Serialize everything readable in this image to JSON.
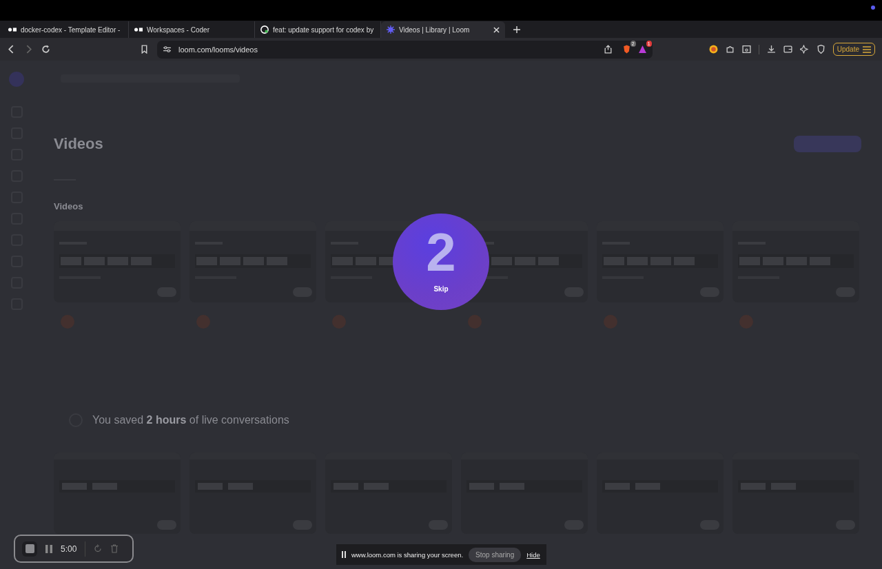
{
  "tabs": [
    {
      "title": "docker-codex - Template Editor -",
      "kind": "coder",
      "selected": false
    },
    {
      "title": "Workspaces - Coder",
      "kind": "coder",
      "selected": false
    },
    {
      "title": "feat: update support for codex by",
      "kind": "github",
      "selected": false
    },
    {
      "title": "Videos | Library | Loom",
      "kind": "loom",
      "selected": true
    }
  ],
  "address": "loom.com/looms/videos",
  "shield_badge": "2",
  "alert_badge": "1",
  "update_button": "Update",
  "page": {
    "title": "Videos",
    "section": "Videos",
    "saved": "You saved **2 hours** of live conversations"
  },
  "countdown": {
    "number": "2",
    "skip": "Skip"
  },
  "recorder": {
    "time": "5:00"
  },
  "share_bar": {
    "message": "www.loom.com is sharing your screen.",
    "stop": "Stop sharing",
    "hide": "Hide"
  }
}
